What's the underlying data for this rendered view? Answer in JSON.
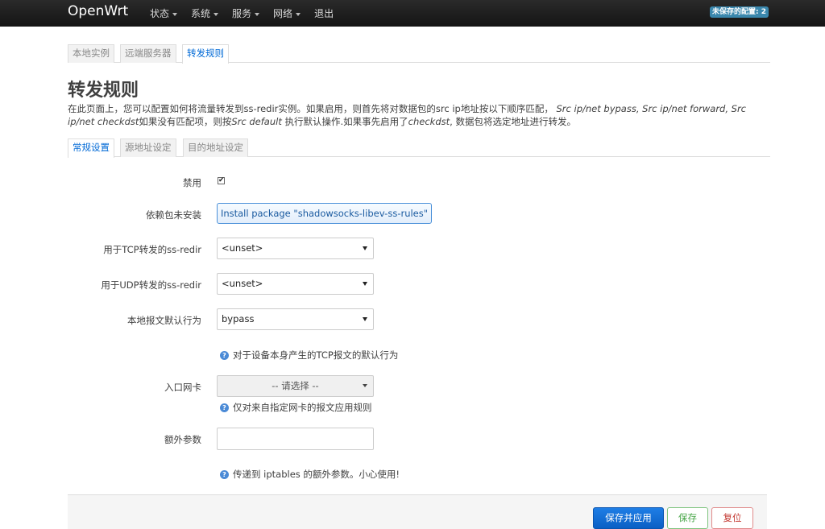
{
  "navbar": {
    "brand": "OpenWrt",
    "menu": [
      "状态",
      "系统",
      "服务",
      "网络"
    ],
    "logout": "退出",
    "unsaved": "未保存的配置: 2"
  },
  "top_tabs": [
    "本地实例",
    "远端服务器",
    "转发规则"
  ],
  "page": {
    "title": "转发规则",
    "desc_part1": "在此页面上，您可以配置如何将流量转发到ss-redir实例。如果启用，则首先将对数据包的src ip地址按以下顺序匹配，",
    "desc_italic1": "Src ip/net bypass, Src ip/net forward, Src ip/net checkdst",
    "desc_part2": "如果没有匹配项，则按",
    "desc_italic2": "Src default",
    "desc_part3": " 执行默认操作.如果事先启用了",
    "desc_italic3": "checkdst",
    "desc_part4": ", 数据包将选定地址进行转发。"
  },
  "sub_tabs": [
    "常规设置",
    "源地址设定",
    "目的地址设定"
  ],
  "form": {
    "disable_label": "禁用",
    "disable_checked": true,
    "dep_label": "依赖包未安装",
    "install_button": "Install package \"shadowsocks-libev-ss-rules\"",
    "tcp_label": "用于TCP转发的ss-redir",
    "tcp_value": "<unset>",
    "udp_label": "用于UDP转发的ss-redir",
    "udp_value": "<unset>",
    "local_label": "本地报文默认行为",
    "local_value": "bypass",
    "local_hint": "对于设备本身产生的TCP报文的默认行为",
    "ifname_label": "入口网卡",
    "ifname_value": "-- 请选择 --",
    "ifname_hint": "仅对来自指定网卡的报文应用规则",
    "extra_label": "额外参数",
    "extra_value": "",
    "extra_hint": "传递到 iptables 的额外参数。小心使用!"
  },
  "footer": {
    "apply": "保存并应用",
    "save": "保存",
    "reset": "复位"
  }
}
